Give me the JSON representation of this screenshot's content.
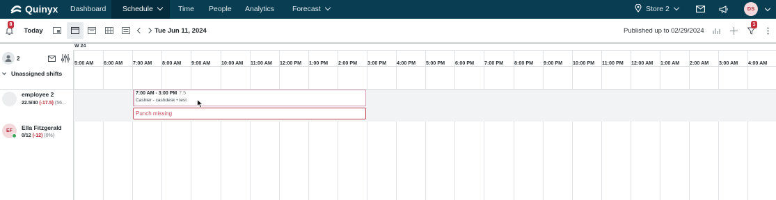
{
  "nav": {
    "logo": "Quinyx",
    "items": [
      {
        "label": "Dashboard"
      },
      {
        "label": "Schedule"
      },
      {
        "label": "Time"
      },
      {
        "label": "People"
      },
      {
        "label": "Analytics"
      },
      {
        "label": "Forecast"
      }
    ],
    "store": "Store 2",
    "user_initials": "DS"
  },
  "toolbar": {
    "notifications_count": "8",
    "today_label": "Today",
    "date": "Tue Jun 11, 2024",
    "published": "Published up to 02/29/2024",
    "filter_count": "1"
  },
  "ruler": {
    "week": "W 24",
    "employee_count": "2",
    "hours": [
      "5:00 AM",
      "6:00 AM",
      "7:00 AM",
      "8:00 AM",
      "9:00 AM",
      "10:00 AM",
      "11:00 AM",
      "12:00 PM",
      "1:00 PM",
      "2:00 PM",
      "3:00 PM",
      "4:00 PM",
      "5:00 PM",
      "6:00 PM",
      "7:00 PM",
      "8:00 PM",
      "9:00 PM",
      "10:00 PM",
      "11:00 PM",
      "12:00 AM",
      "1:00 AM",
      "2:00 AM",
      "3:00 AM",
      "4:00 AM"
    ]
  },
  "unassigned": {
    "label": "Unassigned shifts"
  },
  "employees": [
    {
      "name": "employee 2",
      "hours": "22.5/40",
      "diff": "(-17.5)",
      "pct": "(56..."
    },
    {
      "name": "Ella Fitzgerald",
      "initials": "EF",
      "hours": "0/12",
      "diff": "(-12)",
      "pct": "(0%)"
    }
  ],
  "shift": {
    "time": "7:00 AM - 3:00 PM",
    "duration": "7.5",
    "details": "Cashier - cashdesk • test",
    "punch": "Punch missing"
  },
  "colors": {
    "nav_bg": "#083d52",
    "accent_pink": "#d9a3b6",
    "alert_red": "#c5485a"
  }
}
